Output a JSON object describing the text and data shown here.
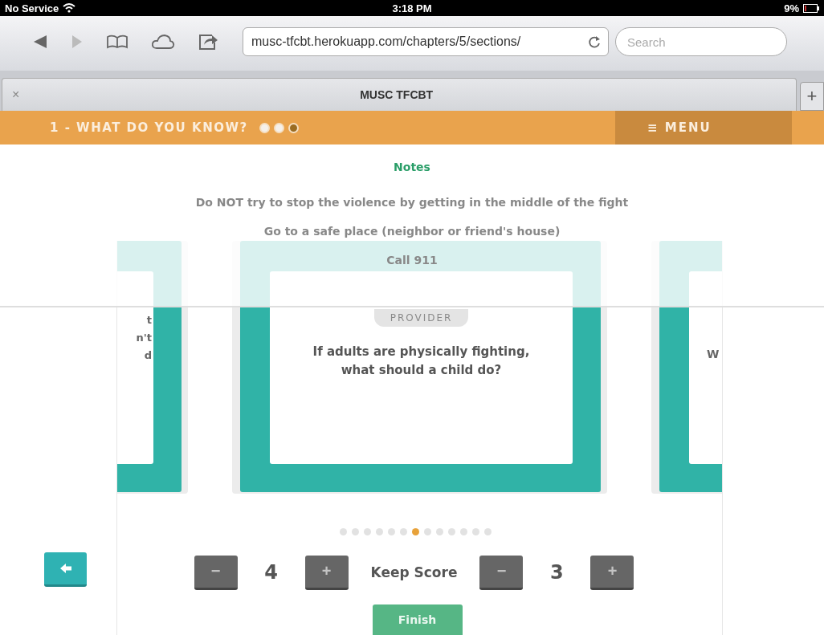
{
  "status_bar": {
    "carrier": "No Service",
    "time": "3:18 PM",
    "battery": "9%"
  },
  "browser": {
    "url": "musc-tfcbt.herokuapp.com/chapters/5/sections/",
    "search": {
      "placeholder": "Search"
    },
    "tab": {
      "close": "×",
      "title": "MUSC TFCBT",
      "new_tab": "+"
    }
  },
  "header": {
    "title": "1 - WHAT DO YOU KNOW?",
    "steps": [
      {
        "completed": true,
        "selected": false
      },
      {
        "completed": true,
        "selected": false
      },
      {
        "completed": false,
        "selected": true
      }
    ],
    "menu": {
      "icon": "≡",
      "label": "MENU"
    }
  },
  "notes": {
    "title": "Notes",
    "lines": [
      "Do NOT try to stop the violence by getting in the middle of the fight",
      "Go to a safe place (neighbor or friend's house)",
      "Call 911"
    ]
  },
  "cards": [
    {
      "kind": "side_left",
      "lines": [
        "t",
        "n't",
        "d"
      ]
    },
    {
      "kind": "main",
      "tag": "PROVIDER",
      "lines": [
        "If adults are physically fighting,",
        "what should a child do?"
      ]
    },
    {
      "kind": "side_right",
      "lines": [
        "W"
      ]
    }
  ],
  "pager": [
    {
      "selected": false
    },
    {
      "selected": false
    },
    {
      "selected": false
    },
    {
      "selected": false
    },
    {
      "selected": false
    },
    {
      "selected": false
    },
    {
      "selected": true
    },
    {
      "selected": false
    },
    {
      "selected": false
    },
    {
      "selected": false
    },
    {
      "selected": false
    },
    {
      "selected": false
    },
    {
      "selected": false
    }
  ],
  "score": {
    "label": "Keep Score",
    "left": {
      "minus": "−",
      "value": "4",
      "plus": "+"
    },
    "right": {
      "minus": "−",
      "value": "3",
      "plus": "+"
    }
  },
  "finish": "Finish"
}
